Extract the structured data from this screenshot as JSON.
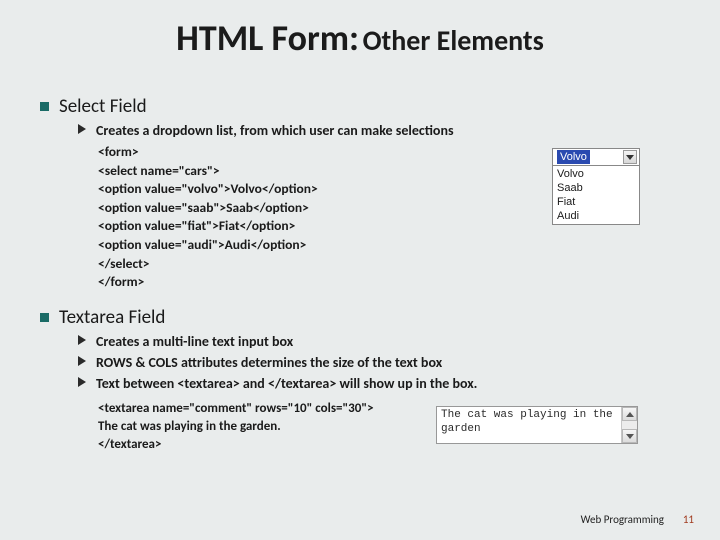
{
  "title": {
    "main": "HTML Form:",
    "sub": "Other Elements"
  },
  "sections": [
    {
      "heading": "Select Field",
      "bullets": [
        "Creates a dropdown list, from which user can make selections"
      ],
      "code": [
        "<form>",
        " <select name=\"cars\">",
        " <option value=\"volvo\">Volvo</option>",
        " <option value=\"saab\">Saab</option>",
        " <option value=\"fiat\">Fiat</option>",
        " <option value=\"audi\">Audi</option>",
        " </select>",
        " </form>"
      ]
    },
    {
      "heading": "Textarea Field",
      "bullets": [
        "Creates a multi-line text input box",
        "ROWS & COLS attributes determines the size of the text box",
        "Text between <textarea> and </textarea> will show up in the box."
      ],
      "code": [
        "<textarea  name=\"comment\" rows=\"10\"  cols=\"30\">",
        "The cat was playing in the garden.",
        "</textarea>"
      ]
    }
  ],
  "dropdown_widget": {
    "selected": "Volvo",
    "options": [
      "Volvo",
      "Saab",
      "Fiat",
      "Audi"
    ]
  },
  "textarea_widget": {
    "text": "The cat was playing in the garden"
  },
  "footer": {
    "label": "Web Programming",
    "page": "11"
  }
}
